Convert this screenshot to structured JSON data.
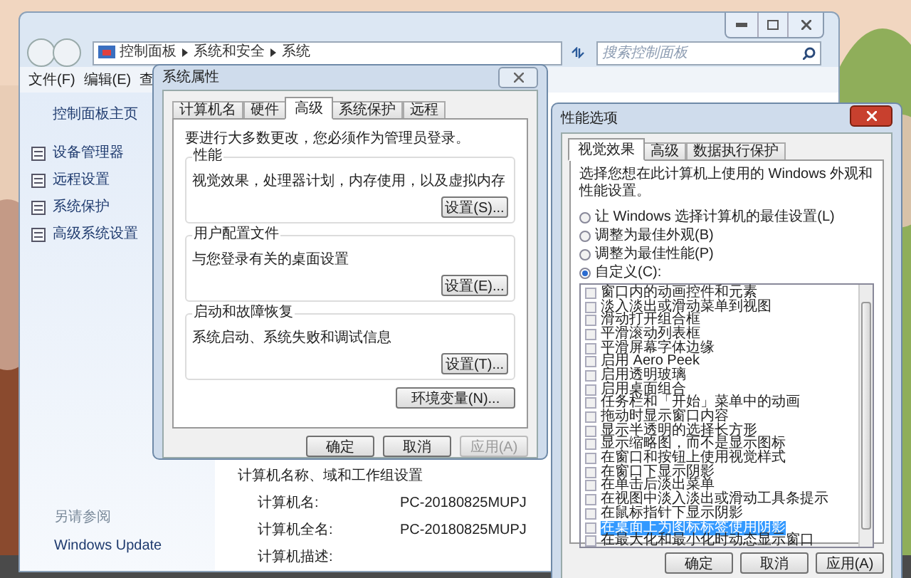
{
  "explorer": {
    "breadcrumb": [
      "控制面板",
      "系统和安全",
      "系统"
    ],
    "search": {
      "placeholder": "搜索控制面板"
    },
    "menu": [
      "文件(F)",
      "编辑(E)",
      "查"
    ],
    "sidebar": {
      "home": "控制面板主页",
      "items": [
        "设备管理器",
        "远程设置",
        "系统保护",
        "高级系统设置"
      ],
      "see_also": "另请参阅",
      "links": [
        "Windows Update"
      ]
    },
    "section_title": "计算机名称、域和工作组设置",
    "fields": [
      {
        "label": "计算机名:",
        "value": "PC-20180825MUPJ"
      },
      {
        "label": "计算机全名:",
        "value": "PC-20180825MUPJ"
      },
      {
        "label": "计算机描述:"
      }
    ]
  },
  "system_properties": {
    "title": "系统属性",
    "tabs": [
      {
        "label": "计算机名",
        "selected": false
      },
      {
        "label": "硬件",
        "selected": false
      },
      {
        "label": "高级",
        "selected": true
      },
      {
        "label": "系统保护",
        "selected": false
      },
      {
        "label": "远程",
        "selected": false
      }
    ],
    "notice": "要进行大多数更改，您必须作为管理员登录。",
    "groups": [
      {
        "title": "性能",
        "description": "视觉效果，处理器计划，内存使用，以及虚拟内存",
        "button": "设置(S)..."
      },
      {
        "title": "用户配置文件",
        "description": "与您登录有关的桌面设置",
        "button": "设置(E)..."
      },
      {
        "title": "启动和故障恢复",
        "description": "系统启动、系统失败和调试信息",
        "button": "设置(T)..."
      }
    ],
    "env_button": "环境变量(N)...",
    "buttons": [
      {
        "label": "确定",
        "disabled": false
      },
      {
        "label": "取消",
        "disabled": false
      },
      {
        "label": "应用(A)",
        "disabled": true
      }
    ]
  },
  "performance_options": {
    "title": "性能选项",
    "tabs": [
      {
        "label": "视觉效果",
        "selected": true
      },
      {
        "label": "高级",
        "selected": false
      },
      {
        "label": "数据执行保护",
        "selected": false
      }
    ],
    "intro": "选择您想在此计算机上使用的 Windows 外观和性能设置。",
    "options": [
      {
        "label": "让 Windows 选择计算机的最佳设置(L)",
        "selected": false
      },
      {
        "label": "调整为最佳外观(B)",
        "selected": false
      },
      {
        "label": "调整为最佳性能(P)",
        "selected": false
      },
      {
        "label": "自定义(C):",
        "selected": true
      }
    ],
    "effects": [
      {
        "label": "窗口内的动画控件和元素",
        "checked": false,
        "selected": false
      },
      {
        "label": "淡入淡出或滑动菜单到视图",
        "checked": false,
        "selected": false
      },
      {
        "label": "滑动打开组合框",
        "checked": false,
        "selected": false
      },
      {
        "label": "平滑滚动列表框",
        "checked": false,
        "selected": false
      },
      {
        "label": "平滑屏幕字体边缘",
        "checked": false,
        "selected": false
      },
      {
        "label": "启用 Aero Peek",
        "checked": false,
        "selected": false
      },
      {
        "label": "启用透明玻璃",
        "checked": false,
        "selected": false
      },
      {
        "label": "启用桌面组合",
        "checked": false,
        "selected": false
      },
      {
        "label": "任务栏和「开始」菜单中的动画",
        "checked": false,
        "selected": false
      },
      {
        "label": "拖动时显示窗口内容",
        "checked": false,
        "selected": false
      },
      {
        "label": "显示半透明的选择长方形",
        "checked": false,
        "selected": false
      },
      {
        "label": "显示缩略图，而不是显示图标",
        "checked": false,
        "selected": false
      },
      {
        "label": "在窗口和按钮上使用视觉样式",
        "checked": false,
        "selected": false
      },
      {
        "label": "在窗口下显示阴影",
        "checked": false,
        "selected": false
      },
      {
        "label": "在单击后淡出菜单",
        "checked": false,
        "selected": false
      },
      {
        "label": "在视图中淡入淡出或滑动工具条提示",
        "checked": false,
        "selected": false
      },
      {
        "label": "在鼠标指针下显示阴影",
        "checked": false,
        "selected": false
      },
      {
        "label": "在桌面上为图标标签使用阴影",
        "checked": false,
        "selected": true
      },
      {
        "label": "在最大化和最小化时动态显示窗口",
        "checked": false,
        "selected": false
      }
    ],
    "buttons": [
      {
        "label": "确定",
        "disabled": false
      },
      {
        "label": "取消",
        "disabled": false
      },
      {
        "label": "应用(A)",
        "disabled": false
      }
    ]
  }
}
